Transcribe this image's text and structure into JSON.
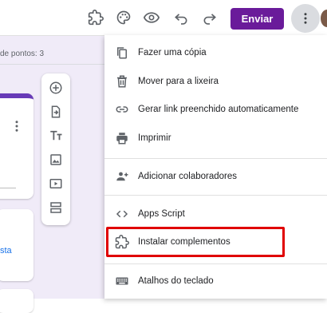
{
  "header": {
    "send_label": "Enviar",
    "icons": [
      "addon-puzzle-icon",
      "palette-icon",
      "preview-eye-icon",
      "undo-icon",
      "redo-icon",
      "more-vert-icon"
    ]
  },
  "background": {
    "points_text": "de pontos: 3",
    "card_link_text": "sta"
  },
  "floating_toolbar": [
    "add-question-icon",
    "import-questions-icon",
    "add-title-icon",
    "add-image-icon",
    "add-video-icon",
    "add-section-icon"
  ],
  "menu": {
    "items": [
      {
        "label": "Fazer uma cópia",
        "icon": "copy-icon"
      },
      {
        "label": "Mover para a lixeira",
        "icon": "trash-icon"
      },
      {
        "label": "Gerar link preenchido automaticamente",
        "icon": "link-icon"
      },
      {
        "label": "Imprimir",
        "icon": "print-icon"
      },
      {
        "label": "Adicionar colaboradores",
        "icon": "add-people-icon"
      },
      {
        "label": "Apps Script",
        "icon": "code-icon"
      },
      {
        "label": "Instalar complementos",
        "icon": "puzzle-icon"
      },
      {
        "label": "Atalhos do teclado",
        "icon": "keyboard-icon"
      }
    ]
  },
  "colors": {
    "accent": "#6a1b9a",
    "background": "#f0ebf8",
    "highlight": "#e00000"
  }
}
